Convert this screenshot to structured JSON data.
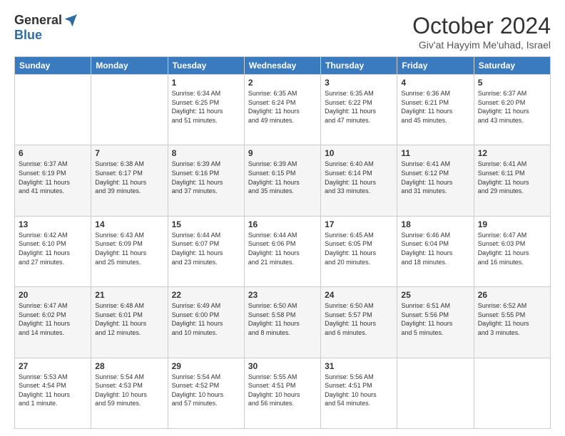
{
  "logo": {
    "general": "General",
    "blue": "Blue"
  },
  "header": {
    "month": "October 2024",
    "location": "Giv'at Hayyim Me'uhad, Israel"
  },
  "weekdays": [
    "Sunday",
    "Monday",
    "Tuesday",
    "Wednesday",
    "Thursday",
    "Friday",
    "Saturday"
  ],
  "weeks": [
    [
      {
        "day": "",
        "info": ""
      },
      {
        "day": "",
        "info": ""
      },
      {
        "day": "1",
        "info": "Sunrise: 6:34 AM\nSunset: 6:25 PM\nDaylight: 11 hours\nand 51 minutes."
      },
      {
        "day": "2",
        "info": "Sunrise: 6:35 AM\nSunset: 6:24 PM\nDaylight: 11 hours\nand 49 minutes."
      },
      {
        "day": "3",
        "info": "Sunrise: 6:35 AM\nSunset: 6:22 PM\nDaylight: 11 hours\nand 47 minutes."
      },
      {
        "day": "4",
        "info": "Sunrise: 6:36 AM\nSunset: 6:21 PM\nDaylight: 11 hours\nand 45 minutes."
      },
      {
        "day": "5",
        "info": "Sunrise: 6:37 AM\nSunset: 6:20 PM\nDaylight: 11 hours\nand 43 minutes."
      }
    ],
    [
      {
        "day": "6",
        "info": "Sunrise: 6:37 AM\nSunset: 6:19 PM\nDaylight: 11 hours\nand 41 minutes."
      },
      {
        "day": "7",
        "info": "Sunrise: 6:38 AM\nSunset: 6:17 PM\nDaylight: 11 hours\nand 39 minutes."
      },
      {
        "day": "8",
        "info": "Sunrise: 6:39 AM\nSunset: 6:16 PM\nDaylight: 11 hours\nand 37 minutes."
      },
      {
        "day": "9",
        "info": "Sunrise: 6:39 AM\nSunset: 6:15 PM\nDaylight: 11 hours\nand 35 minutes."
      },
      {
        "day": "10",
        "info": "Sunrise: 6:40 AM\nSunset: 6:14 PM\nDaylight: 11 hours\nand 33 minutes."
      },
      {
        "day": "11",
        "info": "Sunrise: 6:41 AM\nSunset: 6:12 PM\nDaylight: 11 hours\nand 31 minutes."
      },
      {
        "day": "12",
        "info": "Sunrise: 6:41 AM\nSunset: 6:11 PM\nDaylight: 11 hours\nand 29 minutes."
      }
    ],
    [
      {
        "day": "13",
        "info": "Sunrise: 6:42 AM\nSunset: 6:10 PM\nDaylight: 11 hours\nand 27 minutes."
      },
      {
        "day": "14",
        "info": "Sunrise: 6:43 AM\nSunset: 6:09 PM\nDaylight: 11 hours\nand 25 minutes."
      },
      {
        "day": "15",
        "info": "Sunrise: 6:44 AM\nSunset: 6:07 PM\nDaylight: 11 hours\nand 23 minutes."
      },
      {
        "day": "16",
        "info": "Sunrise: 6:44 AM\nSunset: 6:06 PM\nDaylight: 11 hours\nand 21 minutes."
      },
      {
        "day": "17",
        "info": "Sunrise: 6:45 AM\nSunset: 6:05 PM\nDaylight: 11 hours\nand 20 minutes."
      },
      {
        "day": "18",
        "info": "Sunrise: 6:46 AM\nSunset: 6:04 PM\nDaylight: 11 hours\nand 18 minutes."
      },
      {
        "day": "19",
        "info": "Sunrise: 6:47 AM\nSunset: 6:03 PM\nDaylight: 11 hours\nand 16 minutes."
      }
    ],
    [
      {
        "day": "20",
        "info": "Sunrise: 6:47 AM\nSunset: 6:02 PM\nDaylight: 11 hours\nand 14 minutes."
      },
      {
        "day": "21",
        "info": "Sunrise: 6:48 AM\nSunset: 6:01 PM\nDaylight: 11 hours\nand 12 minutes."
      },
      {
        "day": "22",
        "info": "Sunrise: 6:49 AM\nSunset: 6:00 PM\nDaylight: 11 hours\nand 10 minutes."
      },
      {
        "day": "23",
        "info": "Sunrise: 6:50 AM\nSunset: 5:58 PM\nDaylight: 11 hours\nand 8 minutes."
      },
      {
        "day": "24",
        "info": "Sunrise: 6:50 AM\nSunset: 5:57 PM\nDaylight: 11 hours\nand 6 minutes."
      },
      {
        "day": "25",
        "info": "Sunrise: 6:51 AM\nSunset: 5:56 PM\nDaylight: 11 hours\nand 5 minutes."
      },
      {
        "day": "26",
        "info": "Sunrise: 6:52 AM\nSunset: 5:55 PM\nDaylight: 11 hours\nand 3 minutes."
      }
    ],
    [
      {
        "day": "27",
        "info": "Sunrise: 5:53 AM\nSunset: 4:54 PM\nDaylight: 11 hours\nand 1 minute."
      },
      {
        "day": "28",
        "info": "Sunrise: 5:54 AM\nSunset: 4:53 PM\nDaylight: 10 hours\nand 59 minutes."
      },
      {
        "day": "29",
        "info": "Sunrise: 5:54 AM\nSunset: 4:52 PM\nDaylight: 10 hours\nand 57 minutes."
      },
      {
        "day": "30",
        "info": "Sunrise: 5:55 AM\nSunset: 4:51 PM\nDaylight: 10 hours\nand 56 minutes."
      },
      {
        "day": "31",
        "info": "Sunrise: 5:56 AM\nSunset: 4:51 PM\nDaylight: 10 hours\nand 54 minutes."
      },
      {
        "day": "",
        "info": ""
      },
      {
        "day": "",
        "info": ""
      }
    ]
  ]
}
